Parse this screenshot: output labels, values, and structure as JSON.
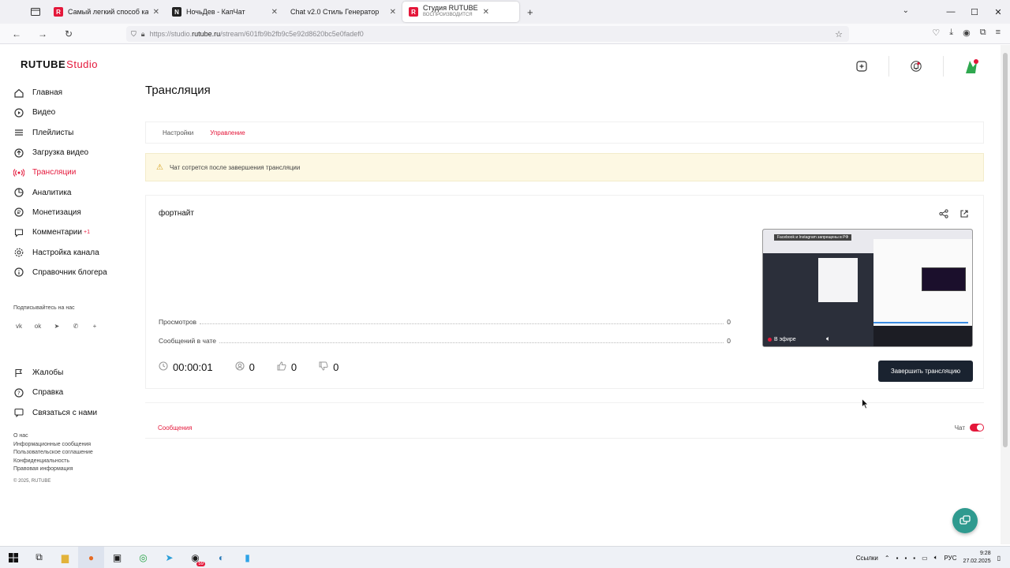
{
  "browser": {
    "tabs": [
      {
        "title": "Самый легкий способ как пос",
        "favicon": "rutube-icon",
        "color": "#e4173a"
      },
      {
        "title": "НочьДев - КапЧат",
        "favicon": "notion-icon",
        "color": "#222222"
      },
      {
        "title": "Chat v2.0 Стиль Генератор",
        "favicon": "",
        "color": ""
      },
      {
        "title": "Студия RUTUBE",
        "subtitle": "ВОСПРОИЗВОДИТСЯ",
        "favicon": "rutube-icon",
        "color": "#e4173a"
      }
    ],
    "url_prefix": "https://studio.",
    "url_domain": "rutube.ru",
    "url_path": "/stream/601fb9b2fb9c5e92d8620bc5e0fadef0"
  },
  "app": {
    "logo_main": "RUTUBE",
    "logo_studio": "Studio",
    "sidebar": [
      {
        "label": "Главная",
        "icon": "home-icon"
      },
      {
        "label": "Видео",
        "icon": "play-circle-icon"
      },
      {
        "label": "Плейлисты",
        "icon": "list-icon"
      },
      {
        "label": "Загрузка видео",
        "icon": "upload-icon"
      },
      {
        "label": "Трансляции",
        "icon": "broadcast-icon",
        "active": true
      },
      {
        "label": "Аналитика",
        "icon": "analytics-icon"
      },
      {
        "label": "Монетизация",
        "icon": "money-icon"
      },
      {
        "label": "Комментарии",
        "icon": "comment-icon",
        "badge": "+1"
      },
      {
        "label": "Настройка канала",
        "icon": "settings-icon"
      },
      {
        "label": "Справочник блогера",
        "icon": "book-icon"
      }
    ],
    "subscribe_label": "Подписывайтесь на нас",
    "socials": [
      "vk-icon",
      "ok-icon",
      "telegram-icon",
      "viber-icon",
      "plus-icon"
    ],
    "sidebar2": [
      {
        "label": "Жалобы",
        "icon": "flag-icon"
      },
      {
        "label": "Справка",
        "icon": "help-icon"
      },
      {
        "label": "Связаться с нами",
        "icon": "chat-icon"
      }
    ],
    "footer_links": [
      "О нас",
      "Информационные сообщения",
      "Пользовательское соглашение",
      "Конфиденциальность",
      "Правовая информация"
    ],
    "copyright": "© 2025, RUTUBE",
    "accent": "#e4173a"
  },
  "page": {
    "title": "Трансляция",
    "tabs": [
      {
        "label": "Настройки",
        "active": false
      },
      {
        "label": "Управление",
        "active": true
      }
    ],
    "warning": "Чат сотрется после завершения трансляции",
    "stream_title": "фортнайт",
    "stats": [
      {
        "label": "Просмотров",
        "value": "0"
      },
      {
        "label": "Сообщений в чате",
        "value": "0"
      }
    ],
    "preview_banner": "Facebook и Instagram запрещены в РФ",
    "preview_live": "В эфире",
    "timer": "00:00:01",
    "viewers": "0",
    "likes": "0",
    "dislikes": "0",
    "end_button": "Завершить трансляцию",
    "messages_tab": "Сообщения",
    "chat_label": "Чат"
  },
  "taskbar": {
    "tray_label": "Ссылки",
    "lang": "РУС",
    "time": "9:28",
    "date": "27.02.2025",
    "badge": "59"
  }
}
